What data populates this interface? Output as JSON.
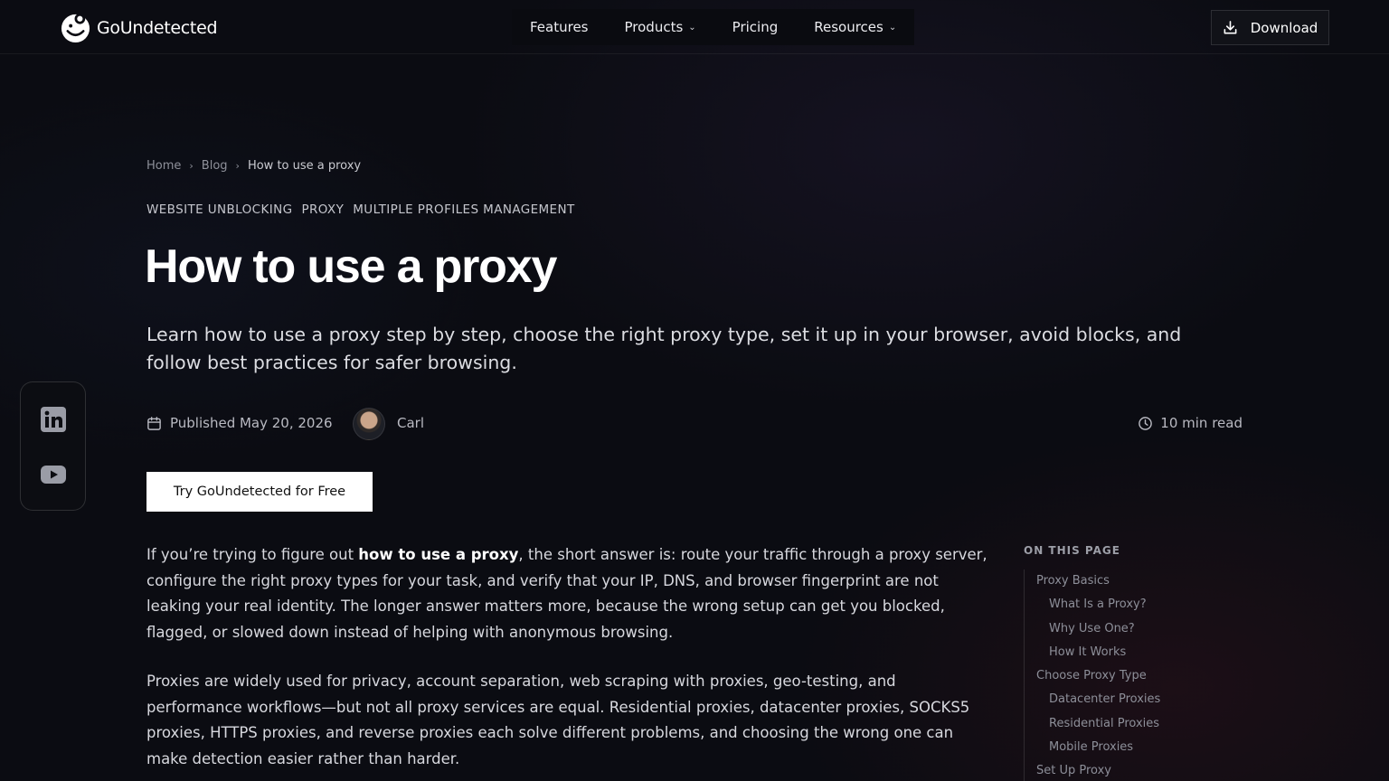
{
  "brand": {
    "name": "GoUndetected"
  },
  "nav": {
    "items": [
      {
        "label": "Features",
        "dropdown": false
      },
      {
        "label": "Products",
        "dropdown": true
      },
      {
        "label": "Pricing",
        "dropdown": false
      },
      {
        "label": "Resources",
        "dropdown": true
      }
    ],
    "download_label": "Download"
  },
  "social": {
    "icons": [
      "linkedin-icon",
      "youtube-icon"
    ]
  },
  "breadcrumb": {
    "home": "Home",
    "blog": "Blog",
    "current": "How to use a proxy"
  },
  "tags": [
    "WEBSITE UNBLOCKING",
    "PROXY",
    "MULTIPLE PROFILES MANAGEMENT"
  ],
  "article": {
    "title": "How to use a proxy",
    "subtitle": "Learn how to use a proxy step by step, choose the right proxy type, set it up in your browser, avoid blocks, and follow best practices for safer browsing.",
    "published": "Published May 20, 2026",
    "author": "Carl",
    "read_time": "10 min read",
    "cta": "Try GoUndetected for Free",
    "p1_pre": "If you’re trying to figure out ",
    "p1_bold": "how to use a proxy",
    "p1_post": ", the short answer is: route your traffic through a proxy server, configure the right proxy types for your task, and verify that your IP, DNS, and browser fingerprint are not leaking your real identity. The longer answer matters more, because the wrong setup can get you blocked, flagged, or slowed down instead of helping with anonymous browsing.",
    "p2": "Proxies are widely used for privacy, account separation, web scraping with proxies, geo-testing, and performance workflows—but not all proxy services are equal. Residential proxies, datacenter proxies, SOCKS5 proxies, HTTPS proxies, and reverse proxies each solve different problems, and choosing the wrong one can make detection easier rather than harder."
  },
  "toc": {
    "title": "ON THIS PAGE",
    "items": [
      {
        "label": "Proxy Basics",
        "level": 1
      },
      {
        "label": "What Is a Proxy?",
        "level": 2
      },
      {
        "label": "Why Use One?",
        "level": 2
      },
      {
        "label": "How It Works",
        "level": 2
      },
      {
        "label": "Choose Proxy Type",
        "level": 1
      },
      {
        "label": "Datacenter Proxies",
        "level": 2
      },
      {
        "label": "Residential Proxies",
        "level": 2
      },
      {
        "label": "Mobile Proxies",
        "level": 2
      },
      {
        "label": "Set Up Proxy",
        "level": 1
      }
    ]
  }
}
